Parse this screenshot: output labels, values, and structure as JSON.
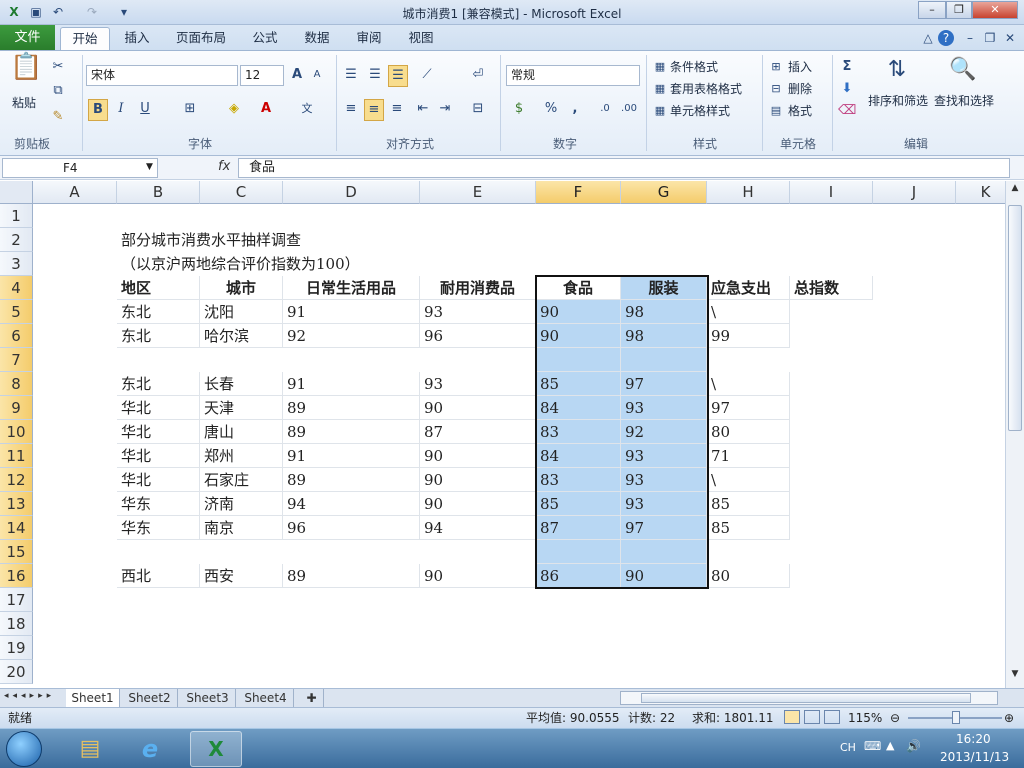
{
  "window": {
    "title": "城市消费1  [兼容模式] - Microsoft Excel"
  },
  "ribbon_tabs": [
    {
      "label": "文件"
    },
    {
      "label": "开始"
    },
    {
      "label": "插入"
    },
    {
      "label": "页面布局"
    },
    {
      "label": "公式"
    },
    {
      "label": "数据"
    },
    {
      "label": "审阅"
    },
    {
      "label": "视图"
    }
  ],
  "ribbon": {
    "clipboard": {
      "paste": "粘贴",
      "group": "剪贴板"
    },
    "font": {
      "name": "宋体",
      "size": "12",
      "group": "字体",
      "bold": "B",
      "italic": "I",
      "underline": "U"
    },
    "align": {
      "group": "对齐方式"
    },
    "number": {
      "format": "常规",
      "group": "数字",
      "percent": "%",
      "comma": ","
    },
    "styles": {
      "cond": "条件格式",
      "table": "套用表格格式",
      "cell": "单元格样式",
      "group": "样式"
    },
    "cells": {
      "insert": "插入",
      "delete": "删除",
      "format": "格式",
      "group": "单元格"
    },
    "edit": {
      "sort": "排序和筛选",
      "find": "查找和选择",
      "group": "编辑",
      "sum": "Σ"
    }
  },
  "formula_bar": {
    "name_box": "F4",
    "fx": "fx",
    "value": "食品"
  },
  "columns": [
    "A",
    "B",
    "C",
    "D",
    "E",
    "F",
    "G",
    "H",
    "I",
    "J",
    "K"
  ],
  "rows": [
    "1",
    "2",
    "3",
    "4",
    "5",
    "6",
    "7",
    "8",
    "9",
    "10",
    "11",
    "12",
    "13",
    "14",
    "15",
    "16",
    "17",
    "18",
    "19",
    "20"
  ],
  "sheet": {
    "title": "部分城市消费水平抽样调查",
    "subtitle": "（以京沪两地综合评价指数为100）",
    "headers": [
      "地区",
      "城市",
      "日常生活用品",
      "耐用消费品",
      "食品",
      "服装",
      "应急支出",
      "总指数"
    ],
    "data": [
      {
        "row": "5",
        "region": "东北",
        "city": "沈阳",
        "daily": "91",
        "durable": "93",
        "food": "90",
        "clothing": "98",
        "emergency": "\\"
      },
      {
        "row": "6",
        "region": "东北",
        "city": "哈尔滨",
        "daily": "92",
        "durable": "96",
        "food": "90",
        "clothing": "98",
        "emergency": "99"
      },
      {
        "row": "8",
        "region": "东北",
        "city": "长春",
        "daily": "91",
        "durable": "93",
        "food": "85",
        "clothing": "97",
        "emergency": "\\"
      },
      {
        "row": "9",
        "region": "华北",
        "city": "天津",
        "daily": "89",
        "durable": "90",
        "food": "84",
        "clothing": "93",
        "emergency": "97"
      },
      {
        "row": "10",
        "region": "华北",
        "city": "唐山",
        "daily": "89",
        "durable": "87",
        "food": "83",
        "clothing": "92",
        "emergency": "80"
      },
      {
        "row": "11",
        "region": "华北",
        "city": "郑州",
        "daily": "91",
        "durable": "90",
        "food": "84",
        "clothing": "93",
        "emergency": "71"
      },
      {
        "row": "12",
        "region": "华北",
        "city": "石家庄",
        "daily": "89",
        "durable": "90",
        "food": "83",
        "clothing": "93",
        "emergency": "\\"
      },
      {
        "row": "13",
        "region": "华东",
        "city": "济南",
        "daily": "94",
        "durable": "90",
        "food": "85",
        "clothing": "93",
        "emergency": "85"
      },
      {
        "row": "14",
        "region": "华东",
        "city": "南京",
        "daily": "96",
        "durable": "94",
        "food": "87",
        "clothing": "97",
        "emergency": "85"
      },
      {
        "row": "16",
        "region": "西北",
        "city": "西安",
        "daily": "89",
        "durable": "90",
        "food": "86",
        "clothing": "90",
        "emergency": "80"
      }
    ]
  },
  "sheet_tabs": [
    "Sheet1",
    "Sheet2",
    "Sheet3",
    "Sheet4"
  ],
  "status": {
    "mode": "就绪",
    "average": "平均值: 90.0555",
    "count": "计数: 22",
    "sum": "求和: 1801.11",
    "zoom": "115%"
  },
  "taskbar": {
    "lang": "CH",
    "time": "16:20",
    "date": "2013/11/13"
  }
}
